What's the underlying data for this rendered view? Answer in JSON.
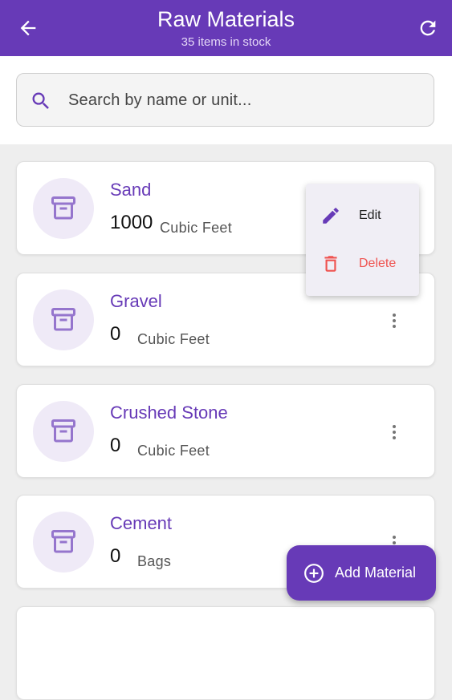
{
  "appbar": {
    "title": "Raw Materials",
    "subtitle": "35 items in stock",
    "back_icon": "arrow-back-icon",
    "refresh_icon": "refresh-icon"
  },
  "search": {
    "placeholder": "Search by name or unit...",
    "icon": "search-icon"
  },
  "items": [
    {
      "name": "Sand",
      "quantity": "1000",
      "unit": "Cubic Feet",
      "icon": "archive-icon"
    },
    {
      "name": "Gravel",
      "quantity": "0",
      "unit": "Cubic Feet",
      "icon": "archive-icon"
    },
    {
      "name": "Crushed Stone",
      "quantity": "0",
      "unit": "Cubic Feet",
      "icon": "archive-icon"
    },
    {
      "name": "Cement",
      "quantity": "0",
      "unit": "Bags",
      "icon": "archive-icon"
    }
  ],
  "context_menu": {
    "edit_label": "Edit",
    "delete_label": "Delete"
  },
  "fab": {
    "label": "Add Material",
    "icon": "add-circle-icon"
  },
  "colors": {
    "primary": "#673ab7",
    "danger": "#ef5350"
  }
}
